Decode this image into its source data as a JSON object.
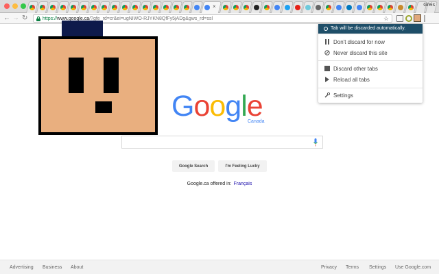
{
  "window": {
    "profile_name": "Greis",
    "colors": {
      "traffic_close": "#fc615d",
      "traffic_min": "#fdbc40",
      "traffic_max": "#34c84a"
    }
  },
  "tabs": {
    "items": [
      {
        "favicon": "chrome-icon"
      },
      {
        "favicon": "chrome-icon"
      },
      {
        "favicon": "chrome-icon"
      },
      {
        "favicon": "chrome-icon"
      },
      {
        "favicon": "chrome-icon"
      },
      {
        "favicon": "chrome-icon"
      },
      {
        "favicon": "chrome-icon"
      },
      {
        "favicon": "chrome-icon"
      },
      {
        "favicon": "chrome-icon"
      },
      {
        "favicon": "chrome-icon"
      },
      {
        "favicon": "chrome-icon"
      },
      {
        "favicon": "chrome-icon"
      },
      {
        "favicon": "chrome-icon"
      },
      {
        "favicon": "chrome-icon"
      },
      {
        "favicon": "chrome-icon"
      },
      {
        "favicon": "chrome-icon"
      },
      {
        "favicon": "google-icon"
      },
      {
        "favicon": "google-icon",
        "active": true
      },
      {
        "favicon": "chrome-icon"
      },
      {
        "favicon": "chrome-icon"
      },
      {
        "favicon": "chrome-icon"
      },
      {
        "favicon": "github-icon"
      },
      {
        "favicon": "chrome-icon"
      },
      {
        "favicon": "google-icon"
      },
      {
        "favicon": "twitter-icon"
      },
      {
        "favicon": "youtube-icon"
      },
      {
        "favicon": "slack-icon"
      },
      {
        "favicon": "puzzle-icon"
      },
      {
        "favicon": "chrome-icon"
      },
      {
        "favicon": "google-icon"
      },
      {
        "favicon": "trello-icon"
      },
      {
        "favicon": "google-icon"
      },
      {
        "favicon": "chrome-icon"
      },
      {
        "favicon": "chrome-icon"
      },
      {
        "favicon": "chrome-icon"
      },
      {
        "favicon": "lion-icon"
      },
      {
        "favicon": "chrome-icon"
      },
      {
        "favicon": "blank-icon"
      },
      {
        "favicon": "blank-icon"
      }
    ]
  },
  "toolbar": {
    "back_icon": "back-arrow-icon",
    "forward_icon": "forward-arrow-icon",
    "reload_icon": "reload-icon",
    "url_scheme": "https://",
    "url_host": "www.google.ca",
    "url_path": "/?gfe_rd=cr&ei=ugNIWO-RJYKN8QfFy5jADg&gws_rd=ssl",
    "bookmark_icon": "star-icon"
  },
  "popup": {
    "header": "Tab will be discarded automatically.",
    "dont_discard": "Don't discard for now",
    "never_discard": "Never discard this site",
    "discard_other": "Discard other tabs",
    "reload_all": "Reload all tabs",
    "settings": "Settings",
    "header_color": "#1e4e68"
  },
  "google": {
    "logo_letters": [
      "G",
      "o",
      "o",
      "g",
      "l",
      "e"
    ],
    "logo_colors": [
      "#4285f4",
      "#ea4335",
      "#fbbc05",
      "#4285f4",
      "#34a853",
      "#ea4335"
    ],
    "country": "Canada",
    "search_button": "Google Search",
    "lucky_button": "I'm Feeling Lucky",
    "offered_in": "Google.ca offered in:",
    "language_link": "Français"
  },
  "footer": {
    "left": [
      "Advertising",
      "Business",
      "About"
    ],
    "right": [
      "Privacy",
      "Terms",
      "Settings",
      "Use Google.com"
    ]
  }
}
